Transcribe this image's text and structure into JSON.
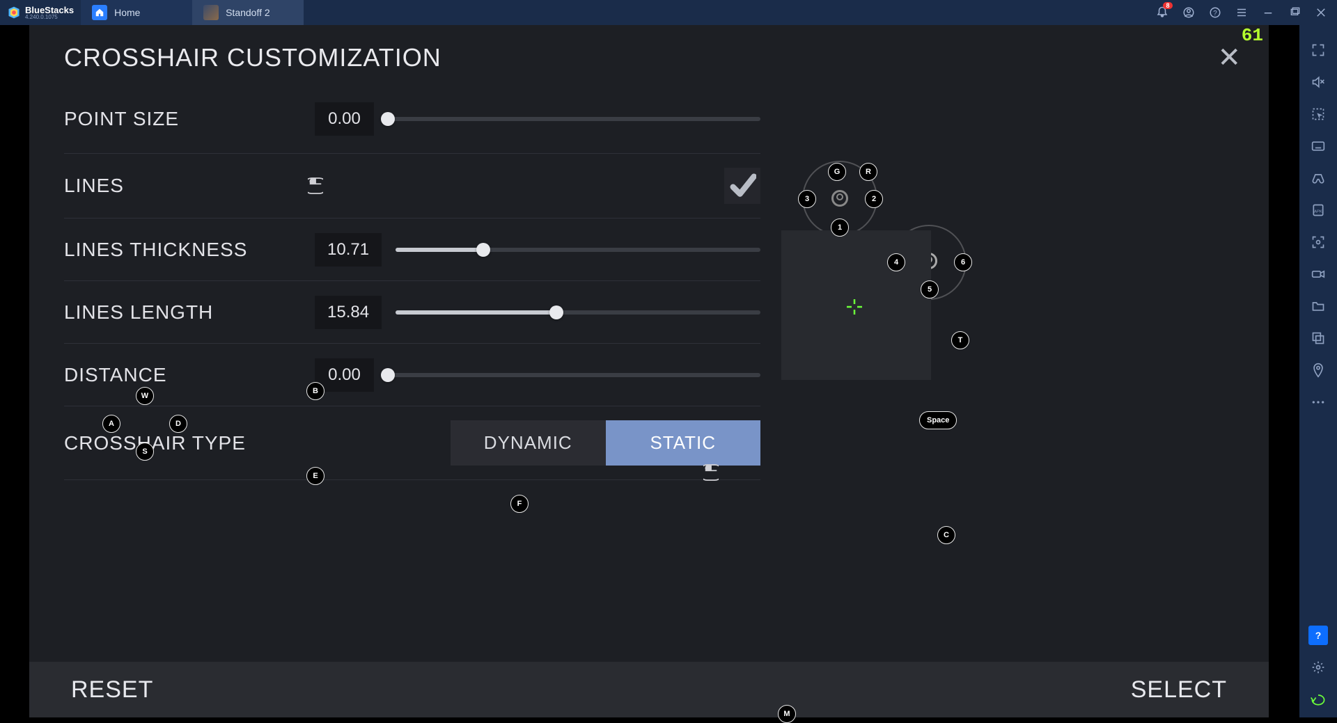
{
  "emulator": {
    "name": "BlueStacks",
    "version": "4.240.0.1075"
  },
  "tabs": {
    "home": "Home",
    "game": "Standoff 2"
  },
  "titlebar": {
    "notif_count": "8"
  },
  "fps": "61",
  "panel": {
    "title": "CROSSHAIR CUSTOMIZATION",
    "labels": {
      "point_size": "POINT SIZE",
      "lines": "LINES",
      "thickness": "LINES THICKNESS",
      "length": "LINES LENGTH",
      "distance": "DISTANCE",
      "type": "CROSSHAIR TYPE"
    },
    "values": {
      "point_size": "0.00",
      "thickness": "10.71",
      "length": "15.84",
      "distance": "0.00"
    },
    "slider_percent": {
      "point_size": 0,
      "thickness": 24,
      "length": 44,
      "distance": 0
    },
    "lines_checked": true,
    "type_options": {
      "dynamic": "DYNAMIC",
      "static": "STATIC"
    },
    "type_selected": "static",
    "footer": {
      "reset": "RESET",
      "select": "SELECT"
    }
  },
  "keys": {
    "G": "G",
    "R": "R",
    "1": "1",
    "2": "2",
    "3": "3",
    "4": "4",
    "5": "5",
    "6": "6",
    "W": "W",
    "A": "A",
    "S": "S",
    "D": "D",
    "B": "B",
    "E": "E",
    "F": "F",
    "T": "T",
    "C": "C",
    "M": "M",
    "Space": "Space"
  }
}
